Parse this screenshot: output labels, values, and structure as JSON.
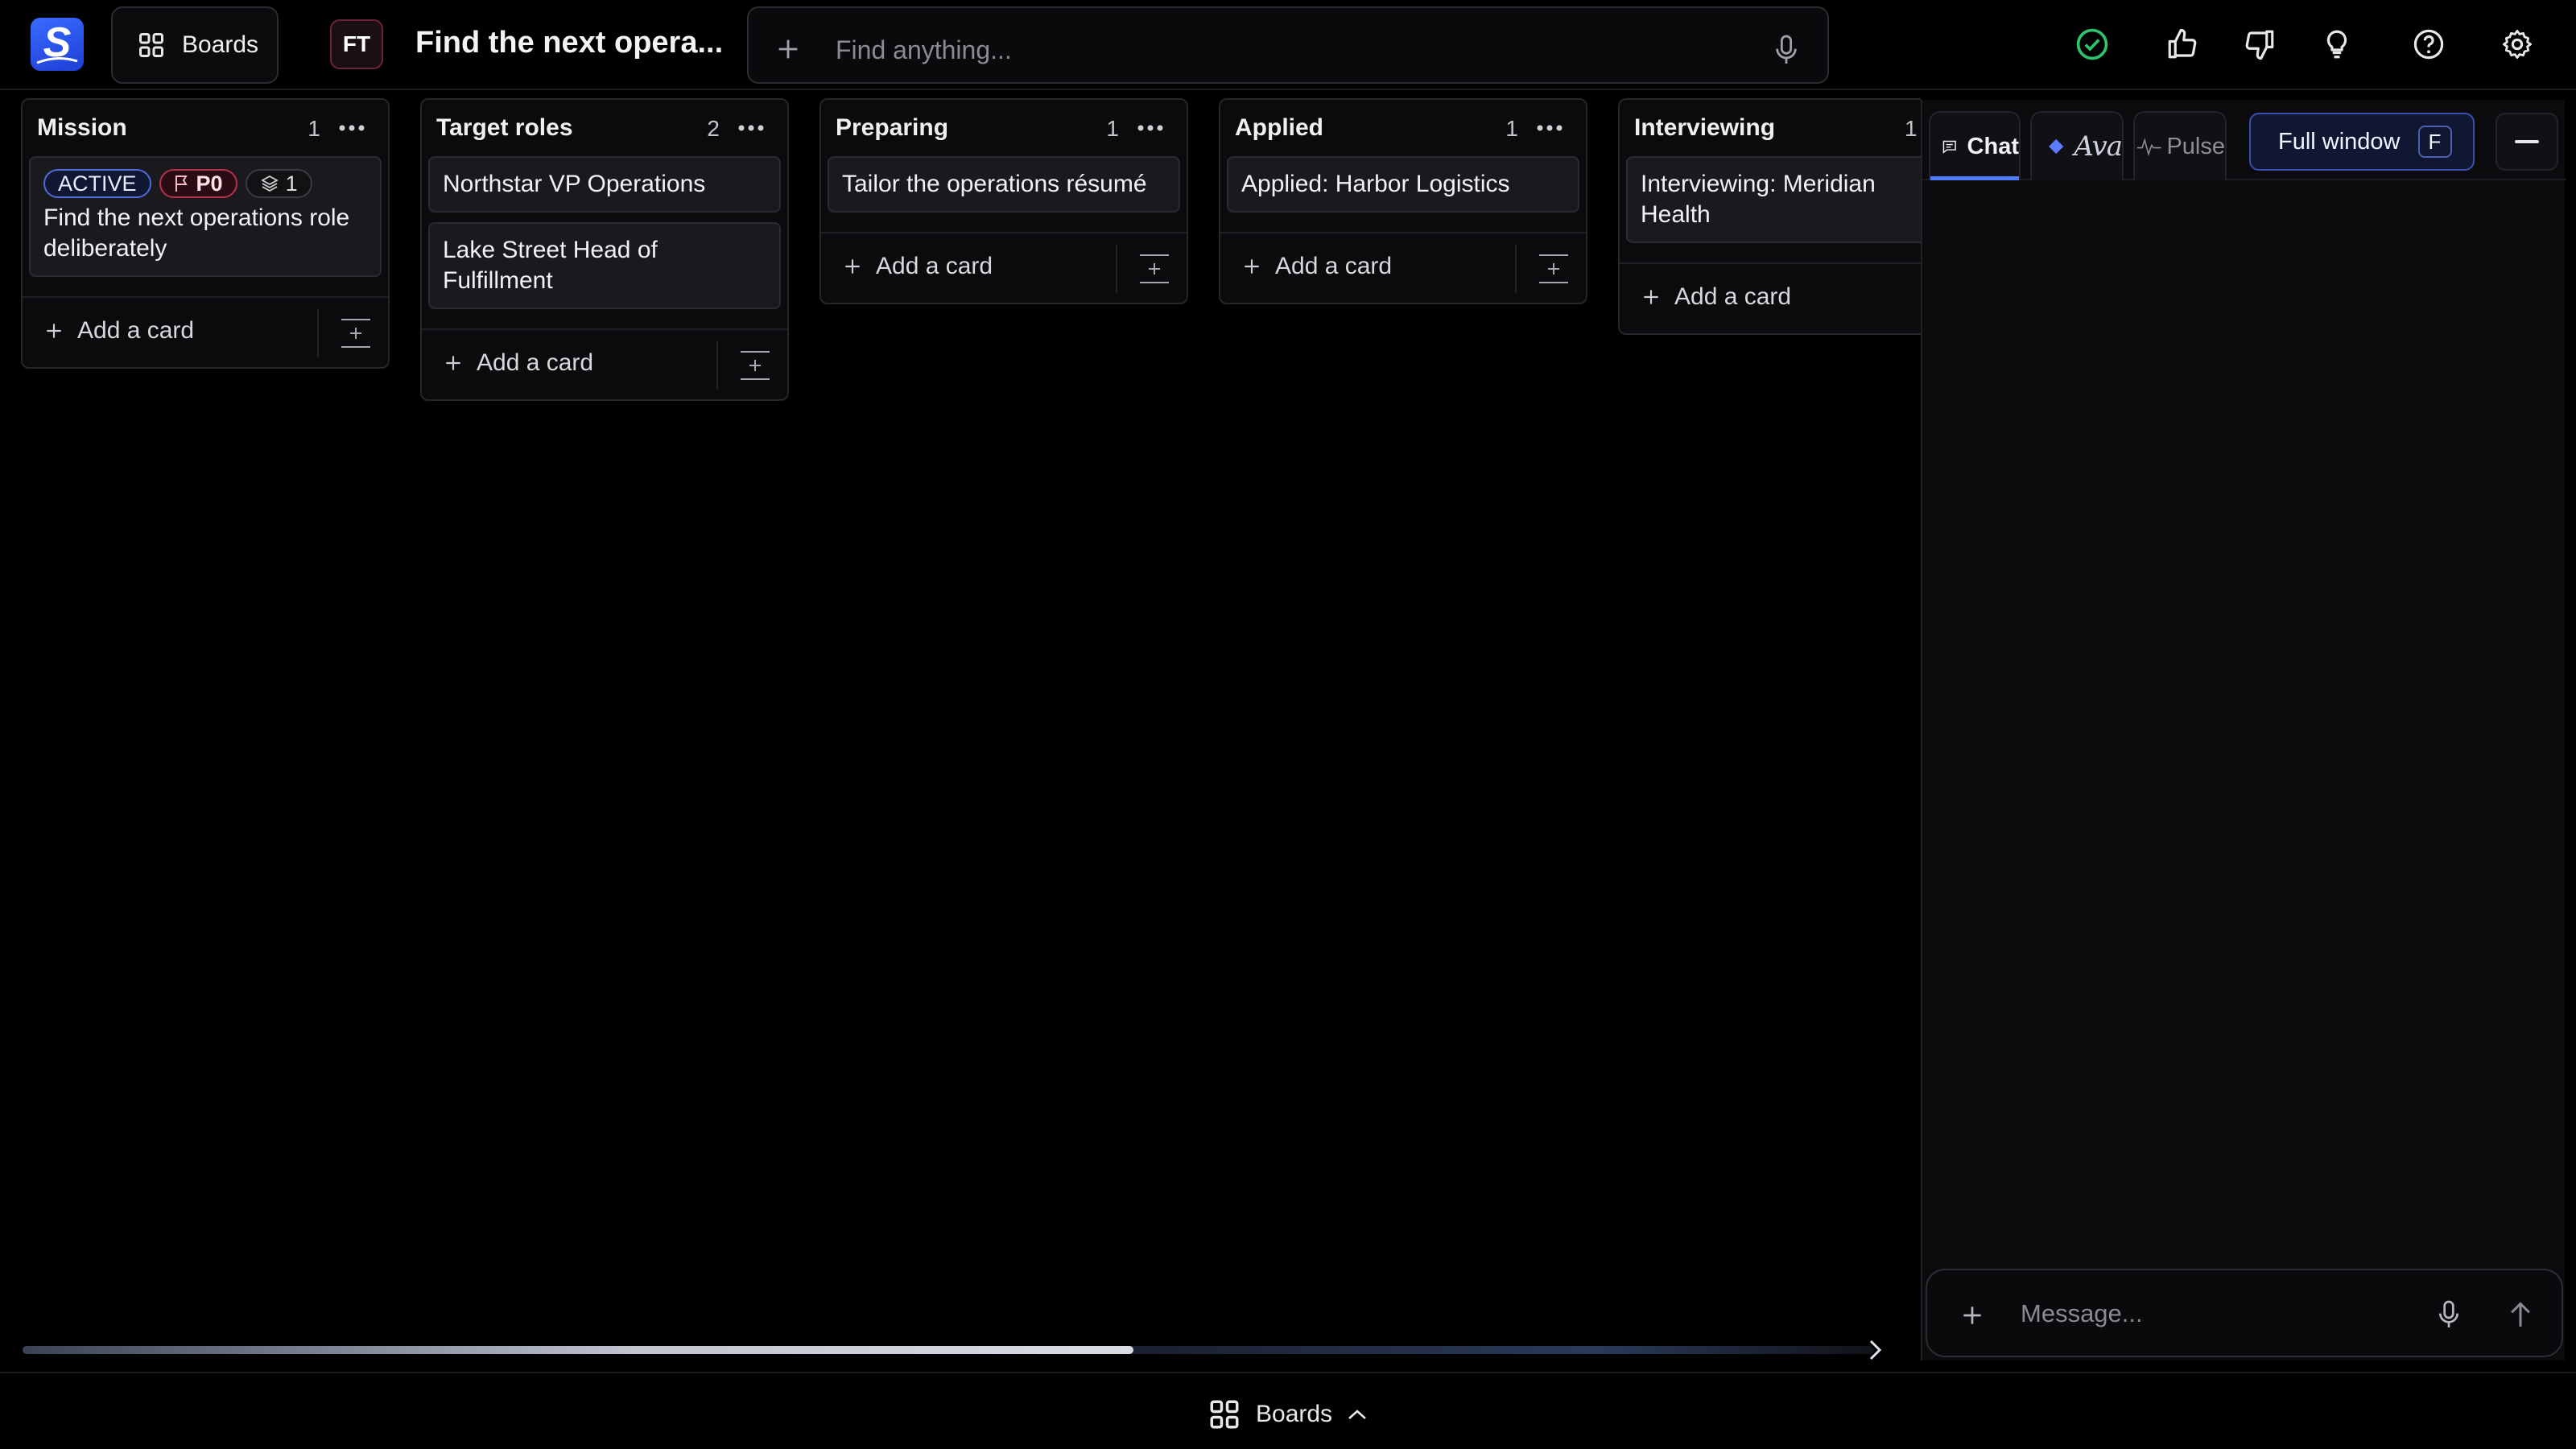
{
  "app": {
    "logo_letter": "S"
  },
  "topbar": {
    "boards_label": "Boards",
    "avatar_initials": "FT",
    "board_title": "Find the next opera...",
    "search_placeholder": "Find anything...",
    "icons": [
      "check-circle-icon",
      "thumbs-up-icon",
      "thumbs-down-icon",
      "lightbulb-icon",
      "help-icon",
      "gear-icon"
    ]
  },
  "columns": [
    {
      "title": "Mission",
      "count": "1",
      "cards": [
        {
          "badges": {
            "active": "ACTIVE",
            "priority": "P0",
            "subtasks": "1"
          },
          "title": "Find the next operations role deliberately"
        }
      ],
      "add_label": "Add a card"
    },
    {
      "title": "Target roles",
      "count": "2",
      "cards": [
        {
          "title": "Northstar VP Operations"
        },
        {
          "title": "Lake Street Head of Fulfillment"
        }
      ],
      "add_label": "Add a card"
    },
    {
      "title": "Preparing",
      "count": "1",
      "cards": [
        {
          "title": "Tailor the operations résumé"
        }
      ],
      "add_label": "Add a card"
    },
    {
      "title": "Applied",
      "count": "1",
      "cards": [
        {
          "title": "Applied: Harbor Logistics"
        }
      ],
      "add_label": "Add a card"
    },
    {
      "title": "Interviewing",
      "count": "1",
      "cards": [
        {
          "title": "Interviewing: Meridian Health"
        }
      ],
      "add_label": "Add a card"
    }
  ],
  "scroll": {
    "horizontal_position": 0.6
  },
  "bottombar": {
    "boards_label": "Boards"
  },
  "panel": {
    "tabs": [
      {
        "label": "Chat",
        "active": true
      },
      {
        "label": "Ava",
        "active": false
      },
      {
        "label": "Pulse",
        "active": false
      }
    ],
    "full_window_label": "Full window",
    "full_window_key": "F",
    "composer_placeholder": "Message..."
  },
  "colors": {
    "accent": "#4f7cff",
    "priority": "#b8324a",
    "success": "#2fc46a",
    "background": "#000000"
  }
}
